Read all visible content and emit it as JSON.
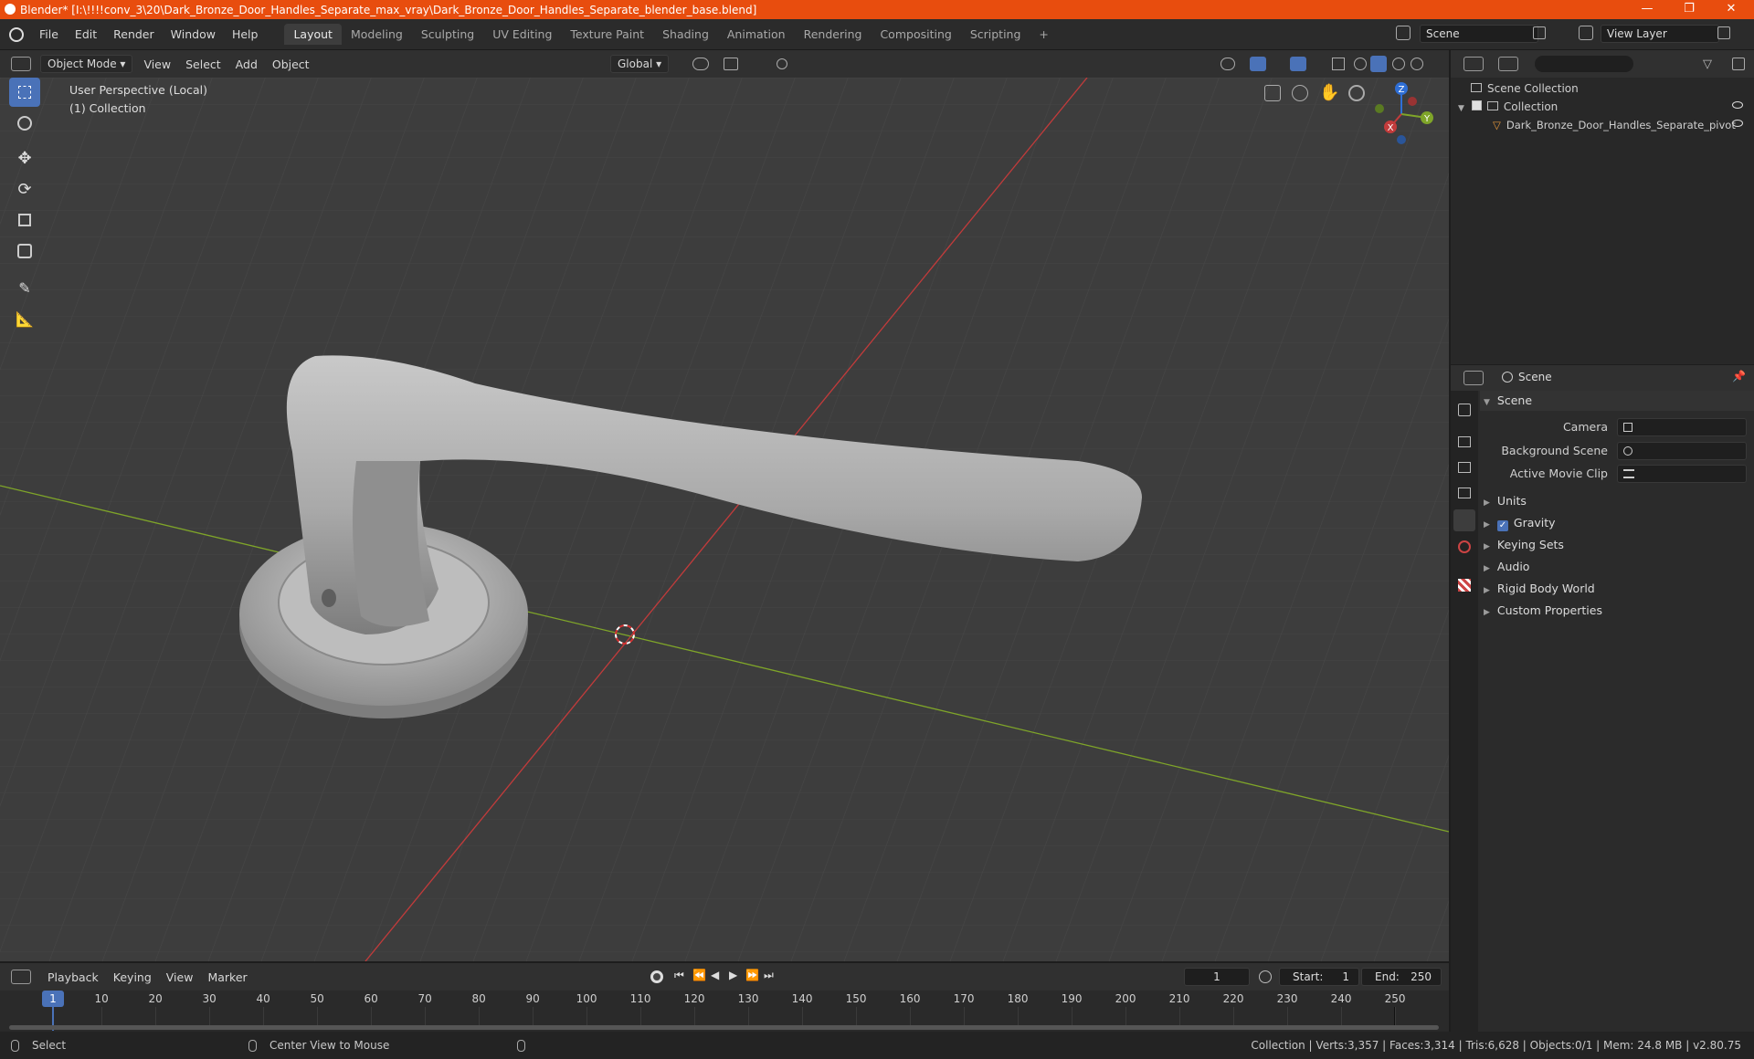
{
  "window": {
    "title": "Blender* [I:\\!!!!conv_3\\20\\Dark_Bronze_Door_Handles_Separate_max_vray\\Dark_Bronze_Door_Handles_Separate_blender_base.blend]",
    "minimize": "—",
    "restore": "❐",
    "close": "✕"
  },
  "menus": [
    "File",
    "Edit",
    "Render",
    "Window",
    "Help"
  ],
  "workspaces": [
    "Layout",
    "Modeling",
    "Sculpting",
    "UV Editing",
    "Texture Paint",
    "Shading",
    "Animation",
    "Rendering",
    "Compositing",
    "Scripting"
  ],
  "active_workspace": "Layout",
  "add_workspace": "+",
  "scene_field": "Scene",
  "view_layer_field": "View Layer",
  "viewport": {
    "mode": "Object Mode",
    "menus": [
      "View",
      "Select",
      "Add",
      "Object"
    ],
    "orientation": "Global",
    "overlay_title": "User Perspective (Local)",
    "overlay_collection": "(1) Collection",
    "gizmo": {
      "x": "X",
      "y": "Y",
      "z": "Z"
    }
  },
  "outliner": {
    "root": "Scene Collection",
    "collection": "Collection",
    "object": "Dark_Bronze_Door_Handles_Separate_pivot"
  },
  "properties": {
    "header": "Scene",
    "panel": "Scene",
    "camera_label": "Camera",
    "background_scene_label": "Background Scene",
    "active_movie_clip_label": "Active Movie Clip",
    "sections": [
      "Units",
      "Gravity",
      "Keying Sets",
      "Audio",
      "Rigid Body World",
      "Custom Properties"
    ],
    "gravity_checked": true
  },
  "timeline": {
    "menus": [
      "Playback",
      "Keying",
      "View",
      "Marker"
    ],
    "current_frame": "1",
    "start_label": "Start:",
    "start_value": "1",
    "end_label": "End:",
    "end_value": "250",
    "ticks": [
      "10",
      "20",
      "30",
      "40",
      "50",
      "60",
      "70",
      "80",
      "90",
      "100",
      "110",
      "120",
      "130",
      "140",
      "150",
      "160",
      "170",
      "180",
      "190",
      "200",
      "210",
      "220",
      "230",
      "240",
      "250"
    ],
    "playhead": "1"
  },
  "status": {
    "left": "Select",
    "middle": "Center View to Mouse",
    "right": "Collection | Verts:3,357 | Faces:3,314 | Tris:6,628 | Objects:0/1 | Mem: 24.8 MB | v2.80.75"
  },
  "colors": {
    "title_bar": "#e84d0e",
    "accent": "#4a72b8",
    "x_axis": "#c23b3b",
    "y_axis": "#7fa529",
    "z_axis": "#2f6fd6"
  }
}
